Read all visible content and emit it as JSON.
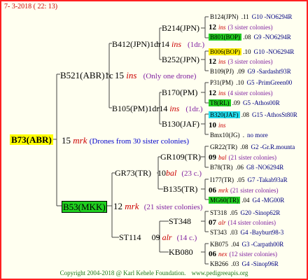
{
  "header": {
    "date": "7-  3-2018 ( 22: 13)"
  },
  "root": {
    "label": "B73(ABR)",
    "number": "15",
    "breed": "mrk",
    "note": "(Drones from 30 sister colonies)",
    "color": "#ffff00"
  },
  "gen1_upper": {
    "label": "B521(ABR)1c",
    "number": "15",
    "breed": "ins",
    "note": "(Only one drone)"
  },
  "gen1_lower": {
    "label": "B53(MKK)",
    "number": "12",
    "breed": "mrk",
    "note": "(21 sister colonies)",
    "color": "#20d020"
  },
  "gen2": [
    {
      "label": "B412(JPN)1dr",
      "number": "14",
      "breed": "ins",
      "note": "(1dr.)"
    },
    {
      "label": "B105(PM)1dr",
      "number": "14",
      "breed": "ins",
      "note": "(1dr.)"
    },
    {
      "label": "GR73(TR)",
      "number": "10",
      "breed": "bal",
      "note": "(23 c.)"
    },
    {
      "label": "ST114",
      "number": "09",
      "breed": "alr",
      "note": "(14 c.)"
    }
  ],
  "gen3": [
    {
      "label": "B214(JPN)"
    },
    {
      "label": "B252(JPN)"
    },
    {
      "label": "B170(PM)"
    },
    {
      "label": "B130(JAF)"
    },
    {
      "label": "GR109(TR)"
    },
    {
      "label": "B135(TR)"
    },
    {
      "label": "ST348"
    },
    {
      "label": "KB080"
    }
  ],
  "gen4": [
    {
      "name": "B124(JPN)",
      "suffix": " .11",
      "id": "G10 -NO6294R",
      "hl": ""
    },
    {
      "name": "12",
      "breed": "ins",
      "note": "(3 sister colonies)"
    },
    {
      "name": "B801(BOP)",
      "suffix": " .08",
      "id": "G9 -NO6294R",
      "hl": "#22cc22"
    },
    {
      "name": "B006(BOP)",
      "suffix": " .10",
      "id": "G10 -NO6294R",
      "hl": "#ffee00"
    },
    {
      "name": "12",
      "breed": "ins",
      "note": "(3 sister colonies)"
    },
    {
      "name": "B109(PJ)",
      "suffix": " .09",
      "id": "G9 -Sardasht93R",
      "hl": ""
    },
    {
      "name": "P31(PM)",
      "suffix": " .10",
      "id": "G5 -PrimGreen00",
      "hl": ""
    },
    {
      "name": "12",
      "breed": "ins",
      "note": "(4 sister colonies)"
    },
    {
      "name": "T8(RL)",
      "suffix": " .09",
      "id": "G5 -Athos00R",
      "hl": "#22cc22"
    },
    {
      "name": "B320(JAF)",
      "suffix": " .08",
      "id": "G15 -AthosSt80R",
      "hl": "#22ddee"
    },
    {
      "name": "10",
      "breed": "ins",
      "note": ""
    },
    {
      "name": "Bmx10(JG)",
      "suffix": " .",
      "id": "no more",
      "hl": ""
    },
    {
      "name": "GR22(TR)",
      "suffix": " .08",
      "id": "G2 -Gr.R.mounta",
      "hl": ""
    },
    {
      "name": "09",
      "breed": "bal",
      "note": "(21 sister colonies)"
    },
    {
      "name": "B78(TR)",
      "suffix": " .06",
      "id": "G8 -NO6294R",
      "hl": ""
    },
    {
      "name": "I177(TR)",
      "suffix": " .05",
      "id": "G7 -Takab93aR",
      "hl": ""
    },
    {
      "name": "06",
      "breed": "mrk",
      "note": "(21 sister colonies)"
    },
    {
      "name": "MG60(TR)",
      "suffix": " .04",
      "id": "G4 -MG00R",
      "hl": "#22cc22"
    },
    {
      "name": "ST318",
      "suffix": " .05",
      "id": "G20 -Sinop62R",
      "hl": ""
    },
    {
      "name": "07",
      "breed": "alr",
      "note": "(14 sister colonies)"
    },
    {
      "name": "ST343",
      "suffix": " .03",
      "id": "G4 -Bayburt98-3",
      "hl": ""
    },
    {
      "name": "KB075",
      "suffix": " .04",
      "id": "G3 -Carpath00R",
      "hl": ""
    },
    {
      "name": "06",
      "breed": "nex",
      "note": "(12 sister colonies)"
    },
    {
      "name": "KB266",
      "suffix": " .03",
      "id": "G4 -Sinop96R",
      "hl": ""
    }
  ],
  "footer": {
    "copyright": "Copyright 2004-2018 @ Karl Kehele Foundation.",
    "url": "www.pedigreeapis.org"
  }
}
